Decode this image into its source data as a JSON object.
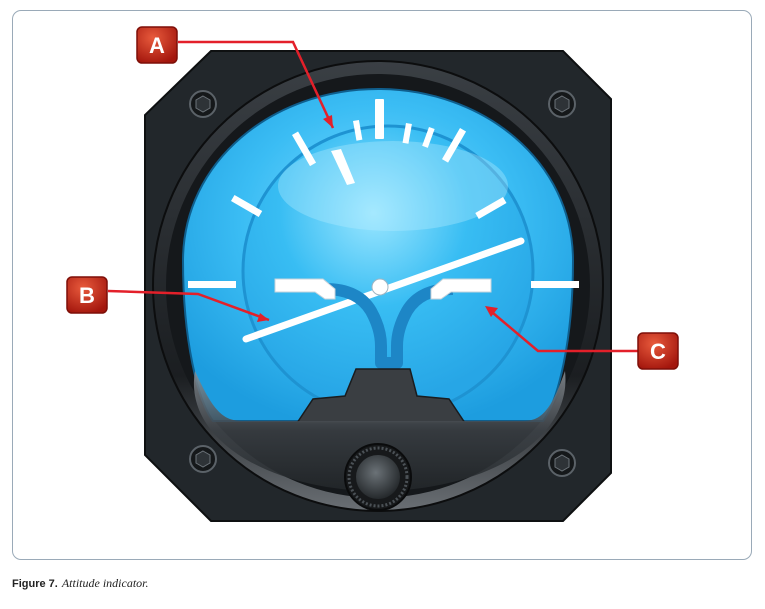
{
  "caption": {
    "figure_label": "Figure 7.",
    "description": "Attitude indicator."
  },
  "callouts": [
    {
      "letter": "A",
      "target": "bank-index-pointer"
    },
    {
      "letter": "B",
      "target": "artificial-horizon-line"
    },
    {
      "letter": "C",
      "target": "miniature-airplane"
    }
  ],
  "colors": {
    "sky": "#2fb3f0",
    "sky_light": "#6fd4fb",
    "case": "#1f2326",
    "callout": "#c8271b",
    "arrow": "#e3202a",
    "frame_border": "#9aaab8"
  }
}
